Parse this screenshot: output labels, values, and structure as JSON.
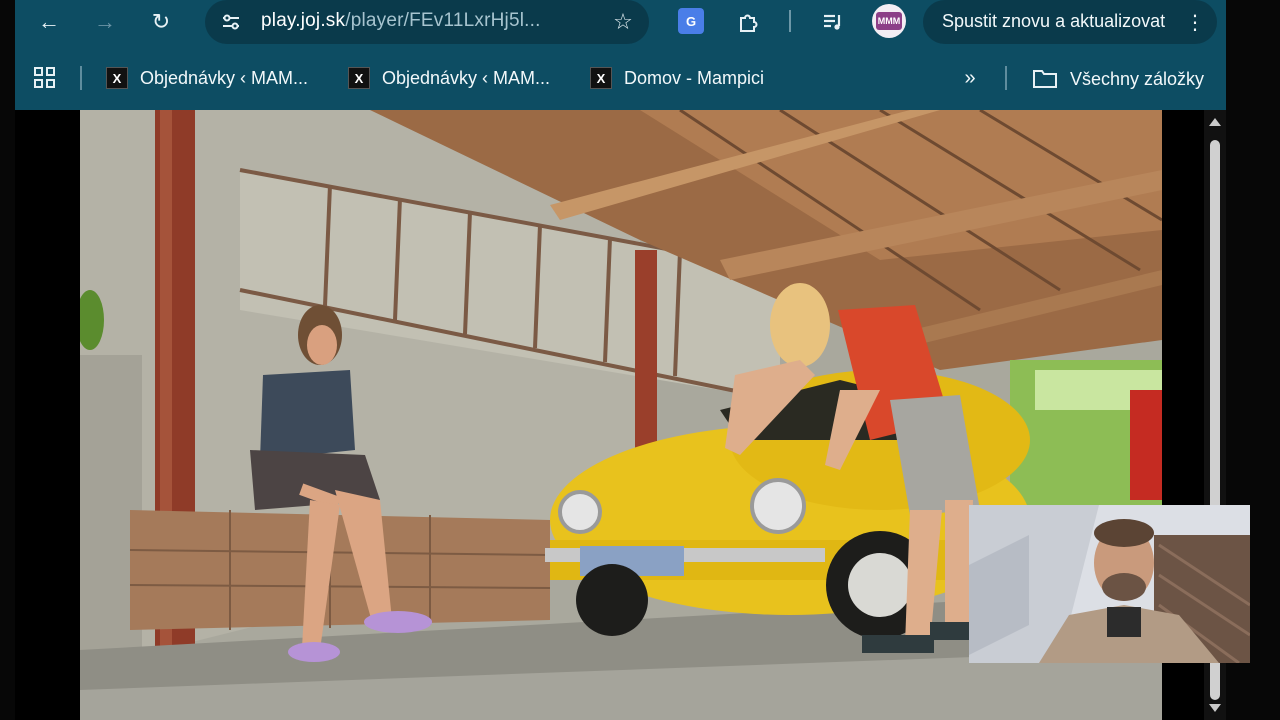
{
  "browser": {
    "url_host": "play.joj.sk",
    "url_path": "/player/FEv11LxrHj5l...",
    "update_button_label": "Spustit znovu a aktualizovat",
    "profile_badge_text": "MMM"
  },
  "bookmarks_bar": {
    "items": [
      {
        "label": "Objednávky ‹ MAM...",
        "favicon_text": "X"
      },
      {
        "label": "Objednávky ‹ MAM...",
        "favicon_text": "X"
      },
      {
        "label": "Domov - Mampici",
        "favicon_text": "X"
      }
    ],
    "overflow_glyph": "»",
    "all_bookmarks_label": "Všechny záložky"
  },
  "icons": {
    "back": "arrow-left-icon",
    "forward": "arrow-right-icon",
    "reload": "reload-icon",
    "site_info": "site-settings-icon",
    "bookmark_star": "star-icon",
    "translate": "google-translate-icon",
    "extensions": "puzzle-icon",
    "media_queue": "queue-music-icon",
    "apps": "apps-grid-icon",
    "folder": "folder-icon",
    "menu": "kebab-menu-icon"
  },
  "colors": {
    "chrome_bg": "#0d4d63",
    "omnibox_bg": "#0a3a4b",
    "car_yellow": "#e8c21d",
    "shirt_red": "#d9482b"
  },
  "video": {
    "description_free": true
  }
}
